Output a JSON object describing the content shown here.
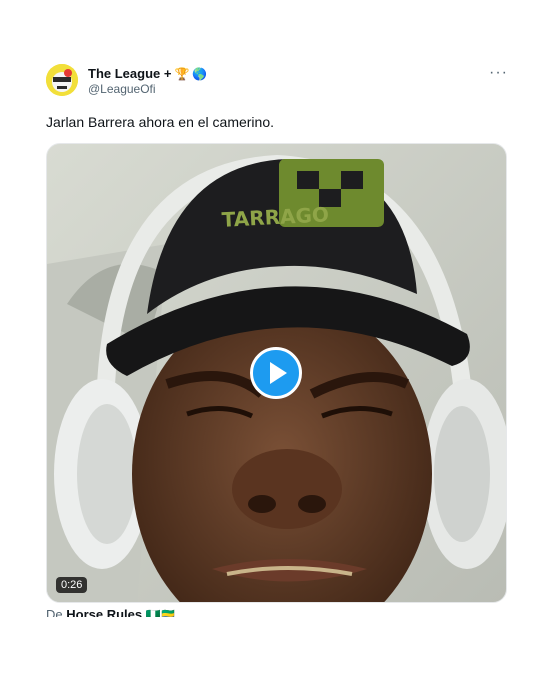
{
  "tweet": {
    "author": {
      "display_name": "The League +",
      "badges": [
        "🏆",
        "🌎"
      ],
      "handle": "@LeagueOfi",
      "avatar": "avatar-image"
    },
    "more_icon": "ellipsis-icon",
    "more_label": "···",
    "text": "Jarlan Barrera ahora en el camerino.",
    "media": {
      "type": "video",
      "duration": "0:26",
      "play_icon": "play-icon",
      "accent": "#1d9bf0",
      "cap_text": "TARRAGO"
    },
    "source": {
      "prefix": "De",
      "name": "Horse Rules",
      "flags": [
        "🇳🇬",
        "🇬🇦"
      ]
    }
  }
}
